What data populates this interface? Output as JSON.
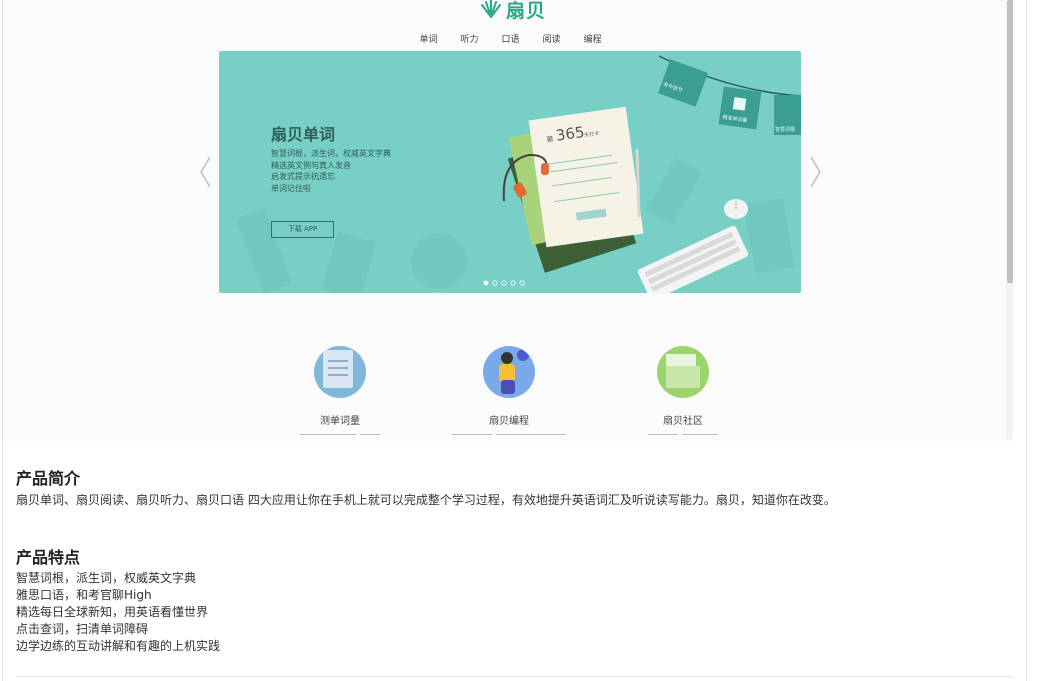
{
  "preview": {
    "logo_text": "扇贝",
    "nav": [
      "单词",
      "听力",
      "口语",
      "阅读",
      "编程"
    ],
    "hero": {
      "title": "扇贝单词",
      "lines": [
        "智慧词根，派生词，权威英文字典",
        "精选英文例句真人发音",
        "启发式提示抗遗忘",
        "单词记住啦"
      ],
      "button": "下载 APP",
      "card_number": "365",
      "card_prefix": "第",
      "card_suffix": "天打卡",
      "tag_labels": [
        "发布音节",
        "精准单词量",
        "智慧词根"
      ],
      "slide_count": 5,
      "active_slide": 1
    },
    "features": [
      {
        "label": "测单词量",
        "color": "#7fb6d9"
      },
      {
        "label": "扇贝编程",
        "color": "#7aa8e8"
      },
      {
        "label": "扇贝社区",
        "color": "#9ad46a"
      }
    ]
  },
  "intro": {
    "title": "产品简介",
    "text": "扇贝单词、扇贝阅读、扇贝听力、扇贝口语 四大应用让你在手机上就可以完成整个学习过程，有效地提升英语词汇及听说读写能力。扇贝，知道你在改变。"
  },
  "features_section": {
    "title": "产品特点",
    "items": [
      "智慧词根，派生词，权威英文字典",
      "雅思口语，和考官聊High",
      "精选每日全球新知，用英语看懂世界",
      "点击查词，扫清单词障碍",
      "边学边练的互动讲解和有趣的上机实践"
    ]
  }
}
